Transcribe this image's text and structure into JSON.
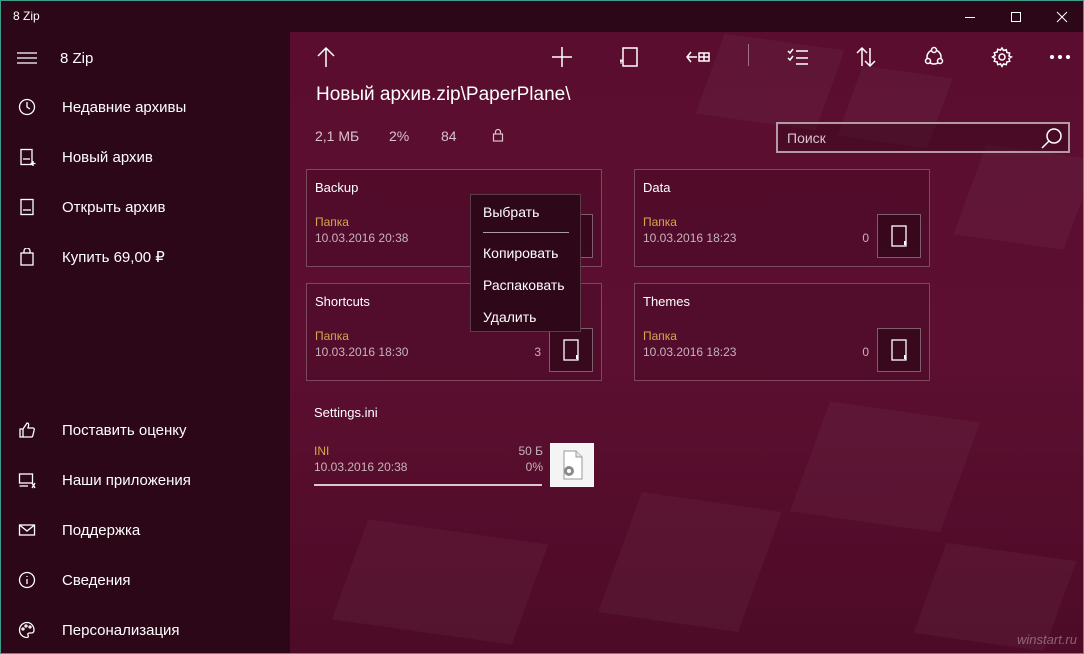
{
  "window": {
    "title": "8 Zip"
  },
  "sidebar": {
    "app_name": "8 Zip",
    "items": [
      {
        "label": "Недавние архивы",
        "icon": "clock-icon"
      },
      {
        "label": "Новый архив",
        "icon": "new-archive-icon"
      },
      {
        "label": "Открыть архив",
        "icon": "open-archive-icon"
      },
      {
        "label": "Купить 69,00 ₽",
        "icon": "shopping-bag-icon"
      }
    ],
    "bottom_items": [
      {
        "label": "Поставить оценку",
        "icon": "thumbs-up-icon"
      },
      {
        "label": "Наши приложения",
        "icon": "apps-icon"
      },
      {
        "label": "Поддержка",
        "icon": "mail-icon"
      },
      {
        "label": "Сведения",
        "icon": "info-icon"
      },
      {
        "label": "Персонализация",
        "icon": "palette-icon"
      }
    ]
  },
  "main": {
    "path": "Новый архив.zip\\PaperPlane\\",
    "stats": {
      "size": "2,1 МБ",
      "ratio": "2%",
      "count": "84"
    },
    "search": {
      "placeholder": "Поиск"
    },
    "folders": [
      {
        "name": "Backup",
        "type": "Папка",
        "date": "10.03.2016 20:38",
        "count": ""
      },
      {
        "name": "Data",
        "type": "Папка",
        "date": "10.03.2016 18:23",
        "count": "0"
      },
      {
        "name": "Shortcuts",
        "type": "Папка",
        "date": "10.03.2016 18:30",
        "count": "3"
      },
      {
        "name": "Themes",
        "type": "Папка",
        "date": "10.03.2016 18:23",
        "count": "0"
      }
    ],
    "file": {
      "name": "Settings.ini",
      "type": "INI",
      "date": "10.03.2016 20:38",
      "size": "50 Б",
      "ratio": "0%"
    }
  },
  "context_menu": {
    "items": [
      "Выбрать",
      "Копировать",
      "Распаковать",
      "Удалить"
    ]
  },
  "watermark": "winstart.ru",
  "colors": {
    "accent": "#5a0d2e",
    "sidebar": "#2b0717",
    "type_label": "#d4a94a",
    "window_border": "#3a9e8a"
  }
}
